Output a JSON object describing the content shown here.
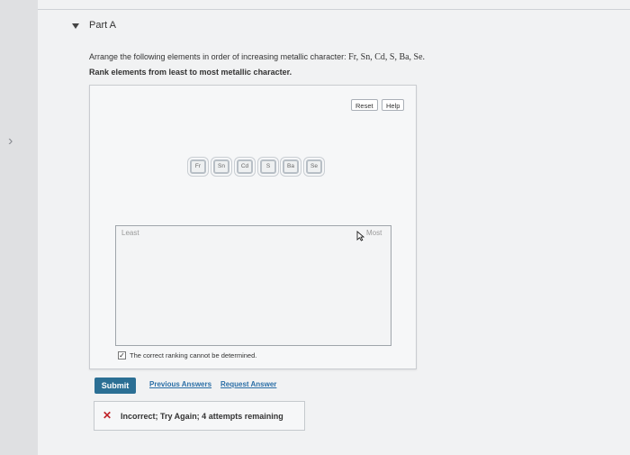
{
  "part": {
    "title": "Part A"
  },
  "question": {
    "prompt": "Arrange the following elements in order of increasing metallic character:",
    "elements_text": "Fr, Sn, Cd, S, Ba, Se.",
    "instruction": "Rank elements from least to most metallic character."
  },
  "toolbar": {
    "reset_label": "Reset",
    "help_label": "Help"
  },
  "tiles": [
    "Fr",
    "Sn",
    "Cd",
    "S",
    "Ba",
    "Se"
  ],
  "ranking": {
    "least_label": "Least",
    "most_label": "Most"
  },
  "checkbox": {
    "label": "The correct ranking cannot be determined.",
    "checked": true
  },
  "actions": {
    "submit_label": "Submit",
    "previous_label": "Previous Answers",
    "request_label": "Request Answer"
  },
  "feedback": {
    "text": "Incorrect; Try Again; 4 attempts remaining"
  },
  "colors": {
    "submit_bg": "#2b6f94",
    "link": "#2a6ea6",
    "error": "#c0242a"
  }
}
